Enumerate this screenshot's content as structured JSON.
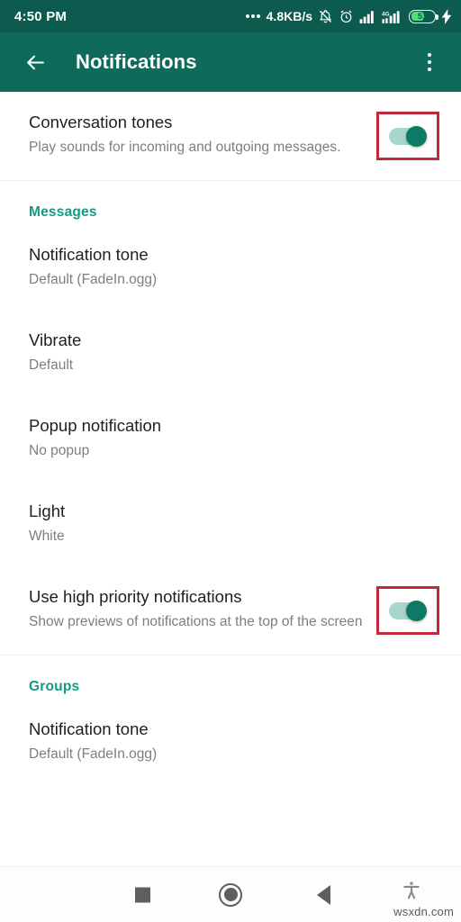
{
  "status_bar": {
    "time": "4:50 PM",
    "network_speed": "4.8KB/s",
    "icons": [
      "overflow-dots",
      "silent-bell-icon",
      "alarm-clock-icon",
      "signal-bars-icon",
      "signal-4g-icon",
      "battery-icon",
      "charging-bolt-icon"
    ],
    "battery_percent": "51",
    "network_type": "4G",
    "bar_color": "#0c5b4e"
  },
  "app_bar": {
    "title": "Notifications",
    "back_icon": "back-arrow-icon",
    "overflow_icon": "more-vertical-icon",
    "color": "#0e6b5b"
  },
  "theme": {
    "accent": "#129b82",
    "toggle_on_thumb": "#0d7a66",
    "toggle_on_track": "#a8d5cc",
    "annotation_box": "#c2293d"
  },
  "settings": [
    {
      "name": "conversation-tones",
      "title": "Conversation tones",
      "subtitle": "Play sounds for incoming and outgoing messages.",
      "control": "switch",
      "value": "on",
      "highlighted": true
    }
  ],
  "sections": [
    {
      "name": "messages",
      "header": "Messages",
      "items": [
        {
          "name": "notification-tone",
          "title": "Notification tone",
          "subtitle": "Default (FadeIn.ogg)",
          "control": "none",
          "highlighted": false
        },
        {
          "name": "vibrate",
          "title": "Vibrate",
          "subtitle": "Default",
          "control": "none",
          "highlighted": false
        },
        {
          "name": "popup-notification",
          "title": "Popup notification",
          "subtitle": "No popup",
          "control": "none",
          "highlighted": false
        },
        {
          "name": "light",
          "title": "Light",
          "subtitle": "White",
          "control": "none",
          "highlighted": false
        },
        {
          "name": "use-high-priority-notifications",
          "title": "Use high priority notifications",
          "subtitle": "Show previews of notifications at the top of the screen",
          "control": "switch",
          "value": "on",
          "highlighted": true
        }
      ]
    },
    {
      "name": "groups",
      "header": "Groups",
      "items": [
        {
          "name": "group-notification-tone",
          "title": "Notification tone",
          "subtitle": "Default (FadeIn.ogg)",
          "control": "none",
          "highlighted": false
        }
      ]
    }
  ],
  "nav_bar": {
    "buttons": [
      {
        "name": "recents-button",
        "icon": "square-icon"
      },
      {
        "name": "home-button",
        "icon": "circle-icon"
      },
      {
        "name": "back-button",
        "icon": "triangle-left-icon"
      },
      {
        "name": "accessibility-button",
        "icon": "accessibility-person-icon"
      }
    ]
  },
  "watermark": "wsxdn.com"
}
